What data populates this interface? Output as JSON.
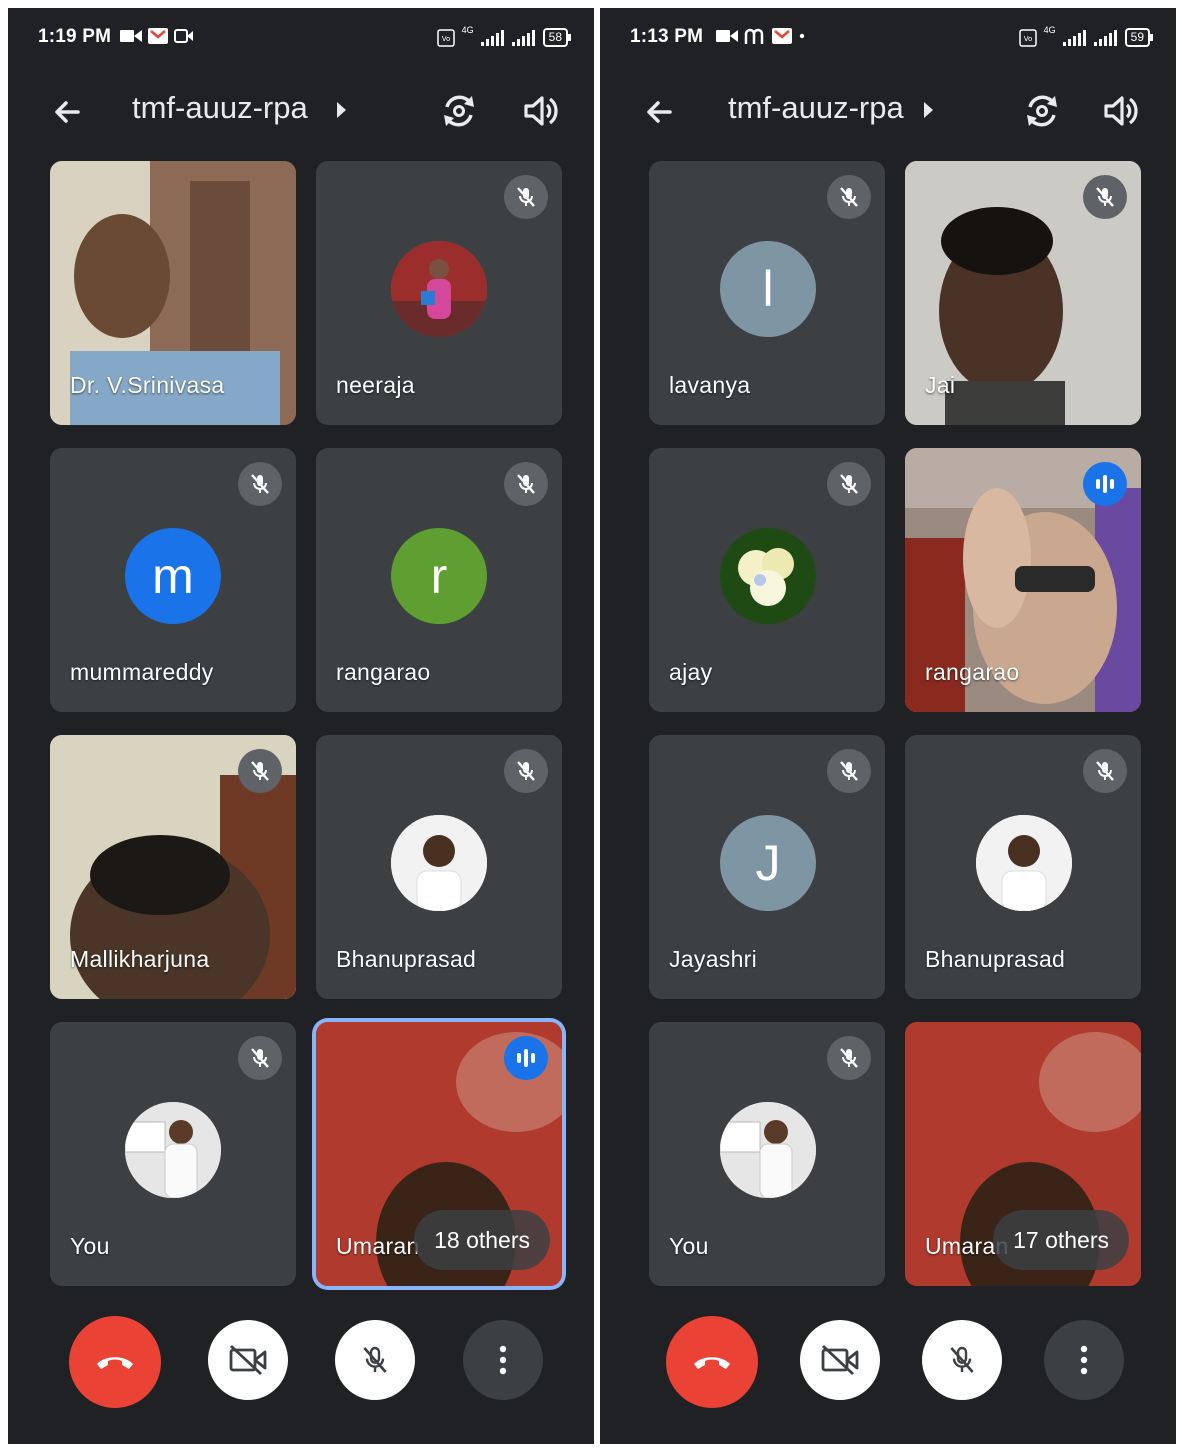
{
  "left": {
    "status": {
      "time": "1:19 PM",
      "battery": "58",
      "net": "4G"
    },
    "toolbar": {
      "meeting_code": "tmf-auuz-rpa"
    },
    "tiles": [
      {
        "name": "Dr. V.Srinivasa"
      },
      {
        "name": "neeraja"
      },
      {
        "name": "mummareddy",
        "initial": "m"
      },
      {
        "name": "rangarao",
        "initial": "r"
      },
      {
        "name": "Mallikharjuna"
      },
      {
        "name": "Bhanuprasad"
      },
      {
        "name": "You"
      },
      {
        "name": "Umaran",
        "others": "18 others"
      }
    ]
  },
  "right": {
    "status": {
      "time": "1:13 PM",
      "battery": "59",
      "net": "4G"
    },
    "toolbar": {
      "meeting_code": "tmf-auuz-rpa"
    },
    "tiles": [
      {
        "name": "lavanya",
        "initial": "l"
      },
      {
        "name": "Jai"
      },
      {
        "name": "ajay"
      },
      {
        "name": "rangarao"
      },
      {
        "name": "Jayashri",
        "initial": "J"
      },
      {
        "name": "Bhanuprasad"
      },
      {
        "name": "You"
      },
      {
        "name": "Umaran",
        "others": "17 others"
      }
    ]
  },
  "colors": {
    "background": "#202124",
    "tile": "#3c4043",
    "end_call": "#ea4335",
    "speaking": "#1a73e8",
    "avatar_m": "#1a73e8",
    "avatar_r": "#5f9e30",
    "avatar_gray": "#7e95a3"
  },
  "icons": [
    "back-arrow-icon",
    "switch-camera-icon",
    "speaker-icon",
    "mic-off-icon",
    "speaking-indicator-icon",
    "end-call-icon",
    "camera-off-icon",
    "more-vert-icon"
  ]
}
